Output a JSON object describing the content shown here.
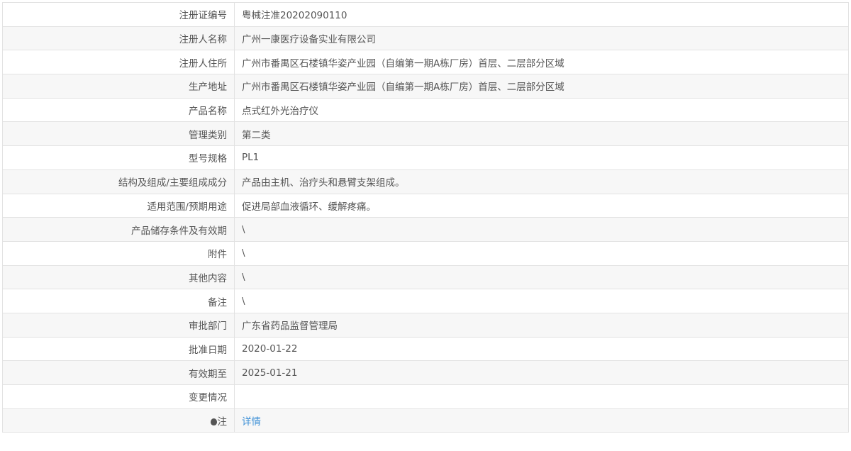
{
  "rows": [
    {
      "label": "注册证编号",
      "value": "粤械注准20202090110"
    },
    {
      "label": "注册人名称",
      "value": "广州一康医疗设备实业有限公司"
    },
    {
      "label": "注册人住所",
      "value": "广州市番禺区石楼镇华姿产业园（自编第一期A栋厂房）首层、二层部分区域"
    },
    {
      "label": "生产地址",
      "value": "广州市番禺区石楼镇华姿产业园（自编第一期A栋厂房）首层、二层部分区域"
    },
    {
      "label": "产品名称",
      "value": "点式红外光治疗仪"
    },
    {
      "label": "管理类别",
      "value": "第二类"
    },
    {
      "label": "型号规格",
      "value": "PL1"
    },
    {
      "label": "结构及组成/主要组成成分",
      "value": "产品由主机、治疗头和悬臂支架组成。"
    },
    {
      "label": "适用范围/预期用途",
      "value": "促进局部血液循环、缓解疼痛。"
    },
    {
      "label": "产品储存条件及有效期",
      "value": "\\"
    },
    {
      "label": "附件",
      "value": "\\"
    },
    {
      "label": "其他内容",
      "value": "\\"
    },
    {
      "label": "备注",
      "value": "\\"
    },
    {
      "label": "审批部门",
      "value": "广东省药品监督管理局"
    },
    {
      "label": "批准日期",
      "value": "2020-01-22"
    },
    {
      "label": "有效期至",
      "value": "2025-01-21"
    },
    {
      "label": "变更情况",
      "value": ""
    }
  ],
  "note": {
    "label": "注",
    "icon": "lightbulb-icon",
    "link": "详情",
    "link_color": "#3b8fd6"
  }
}
